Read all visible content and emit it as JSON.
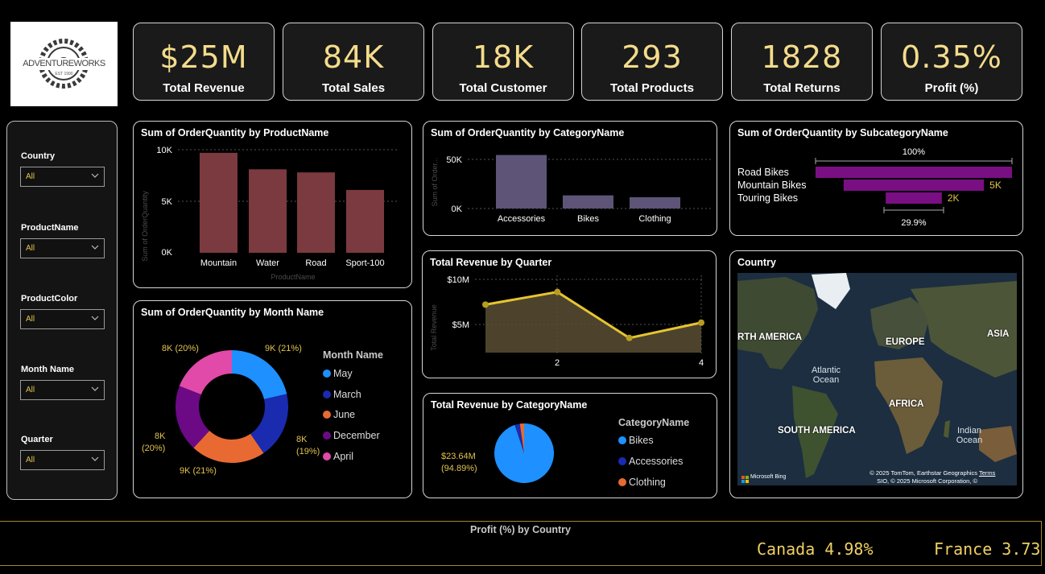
{
  "brand": {
    "logo_text": "ADVENTUREWORKS",
    "logo_sub": "EST 1990"
  },
  "kpis": [
    {
      "value": "$25M",
      "label": "Total Revenue"
    },
    {
      "value": "84K",
      "label": "Total Sales"
    },
    {
      "value": "18K",
      "label": "Total Customer"
    },
    {
      "value": "293",
      "label": "Total Products"
    },
    {
      "value": "1828",
      "label": "Total Returns"
    },
    {
      "value": "0.35%",
      "label": "Profit (%)"
    }
  ],
  "slicers": [
    {
      "label": "Country",
      "value": "All"
    },
    {
      "label": "ProductName",
      "value": "All"
    },
    {
      "label": "ProductColor",
      "value": "All"
    },
    {
      "label": "Month Name",
      "value": "All"
    },
    {
      "label": "Quarter",
      "value": "All"
    }
  ],
  "colors": {
    "accent": "#f4dc8c",
    "bar_product": "#7b3a40",
    "bar_category": "#5d5478",
    "bar_subcategory": "#7a0f83",
    "line": "#e6c530",
    "area": "#5a4f35"
  },
  "charts": {
    "product": {
      "title": "Sum of OrderQuantity by ProductName",
      "ylabel": "Sum of OrderQuantity",
      "xlabel": "ProductName",
      "yticks": [
        "10K",
        "5K",
        "0K"
      ]
    },
    "category": {
      "title": "Sum of OrderQuantity by CategoryName",
      "ylabel": "Sum of Order...",
      "yticks": [
        "50K",
        "0K"
      ]
    },
    "subcategory": {
      "title": "Sum of OrderQuantity by SubcategoryName",
      "top_label": "100%",
      "bottom_label": "29.9%"
    },
    "month": {
      "title": "Sum of OrderQuantity by Month Name",
      "legend_title": "Month Name"
    },
    "quarter": {
      "title": "Total Revenue by Quarter",
      "ylabel": "Total Revenue",
      "yticks": [
        "$10M",
        "$5M"
      ],
      "xticks": [
        "2",
        "4"
      ]
    },
    "revenue_category": {
      "title": "Total Revenue by CategoryName",
      "legend_title": "CategoryName"
    },
    "country_map": {
      "title": "Country",
      "labels": [
        "RTH AMERICA",
        "EUROPE",
        "ASIA",
        "AFRICA",
        "SOUTH AMERICA"
      ],
      "oceans": [
        "Atlantic Ocean",
        "Indian Ocean"
      ],
      "attribution": "© 2025 TomTom, Earthstar Geographics SIO, © 2025 Microsoft Corporation, © OpenStreetMap",
      "terms": "Terms",
      "bing": "Microsoft Bing"
    }
  },
  "chart_data": [
    {
      "type": "bar",
      "title": "Sum of OrderQuantity by ProductName",
      "xlabel": "ProductName",
      "ylabel": "Sum of OrderQuantity",
      "categories": [
        "Mountain",
        "Water",
        "Road",
        "Sport-100"
      ],
      "values": [
        9700,
        8100,
        7800,
        6100
      ],
      "ylim": [
        0,
        10000
      ]
    },
    {
      "type": "bar",
      "title": "Sum of OrderQuantity by CategoryName",
      "ylabel": "Sum of Order...",
      "categories": [
        "Accessories",
        "Bikes",
        "Clothing"
      ],
      "values": [
        57000,
        14000,
        12000
      ],
      "ylim": [
        0,
        60000
      ]
    },
    {
      "type": "bar",
      "title": "Sum of OrderQuantity by SubcategoryName",
      "categories": [
        "Road Bikes",
        "Mountain Bikes",
        "Touring Bikes"
      ],
      "values": [
        7000,
        5000,
        2000
      ],
      "data_labels": [
        "",
        "5K",
        "2K"
      ]
    },
    {
      "type": "pie",
      "title": "Sum of OrderQuantity by Month Name",
      "categories": [
        "May",
        "March",
        "June",
        "December",
        "April"
      ],
      "values": [
        9,
        8,
        9,
        8,
        8
      ],
      "data_labels": [
        "9K (21%)",
        "8K (19%)",
        "9K (21%)",
        "8K (20%)",
        "8K (20%)"
      ],
      "colors": [
        "#1e90ff",
        "#1a2bb0",
        "#e86a32",
        "#6b0a84",
        "#e14aa8"
      ]
    },
    {
      "type": "area",
      "title": "Total Revenue by Quarter",
      "ylabel": "Total Revenue",
      "x": [
        1,
        2,
        3,
        4
      ],
      "values": [
        7.2,
        8.6,
        3.5,
        5.2
      ],
      "yunit": "$M",
      "ylim": [
        0,
        10
      ]
    },
    {
      "type": "pie",
      "title": "Total Revenue by CategoryName",
      "categories": [
        "Bikes",
        "Accessories",
        "Clothing"
      ],
      "values": [
        94.89,
        2.8,
        2.31
      ],
      "data_labels": [
        "$23.64M (94.89%)"
      ],
      "colors": [
        "#1e90ff",
        "#1a2bb0",
        "#e86a32"
      ]
    }
  ],
  "footer": {
    "title": "Profit (%) by Country",
    "ticker": [
      {
        "country": "Canada",
        "value": "4.98%"
      },
      {
        "country": "France",
        "value": "3.73"
      }
    ]
  }
}
